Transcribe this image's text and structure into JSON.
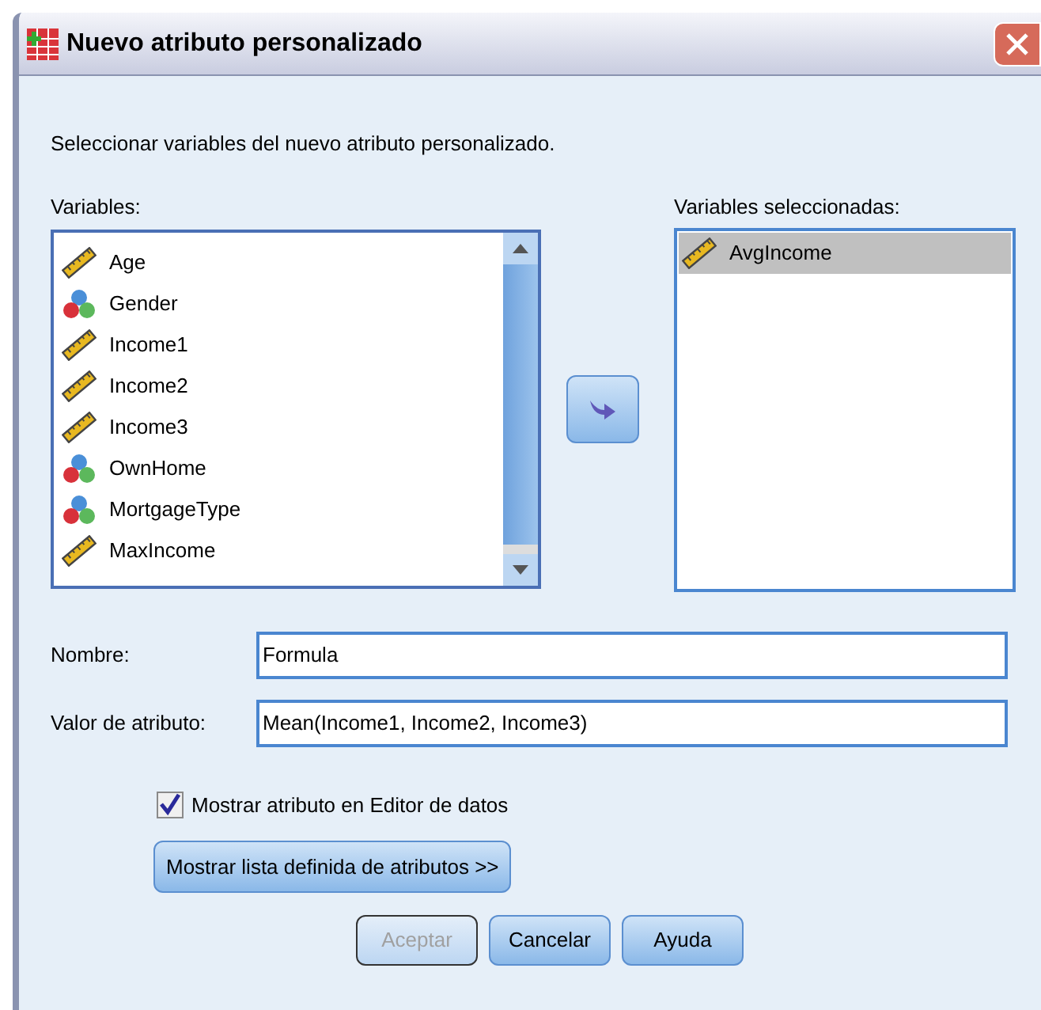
{
  "window": {
    "title": "Nuevo atributo personalizado"
  },
  "instruction": "Seleccionar variables del nuevo atributo personalizado.",
  "variables": {
    "label": "Variables:",
    "items": [
      {
        "name": "Age",
        "kind": "scale",
        "selected": false
      },
      {
        "name": "Gender",
        "kind": "nominal",
        "selected": false
      },
      {
        "name": "Income1",
        "kind": "scale",
        "selected": false
      },
      {
        "name": "Income2",
        "kind": "scale",
        "selected": false
      },
      {
        "name": "Income3",
        "kind": "scale",
        "selected": false
      },
      {
        "name": "OwnHome",
        "kind": "nominal",
        "selected": false
      },
      {
        "name": "MortgageType",
        "kind": "nominal",
        "selected": false
      },
      {
        "name": "MaxIncome",
        "kind": "scale",
        "selected": false
      }
    ]
  },
  "selected_variables": {
    "label": "Variables seleccionadas:",
    "items": [
      {
        "name": "AvgIncome",
        "kind": "scale",
        "selected": true
      }
    ]
  },
  "name_field": {
    "label": "Nombre:",
    "value": "Formula"
  },
  "value_field": {
    "label": "Valor de atributo:",
    "value": "Mean(Income1, Income2, Income3)"
  },
  "show_in_editor": {
    "label": "Mostrar atributo en Editor de datos",
    "checked": true
  },
  "show_list_button": "Mostrar lista definida de atributos >>",
  "buttons": [
    {
      "label": "Aceptar",
      "disabled": true
    },
    {
      "label": "Cancelar",
      "disabled": false
    },
    {
      "label": "Ayuda",
      "disabled": false
    }
  ]
}
